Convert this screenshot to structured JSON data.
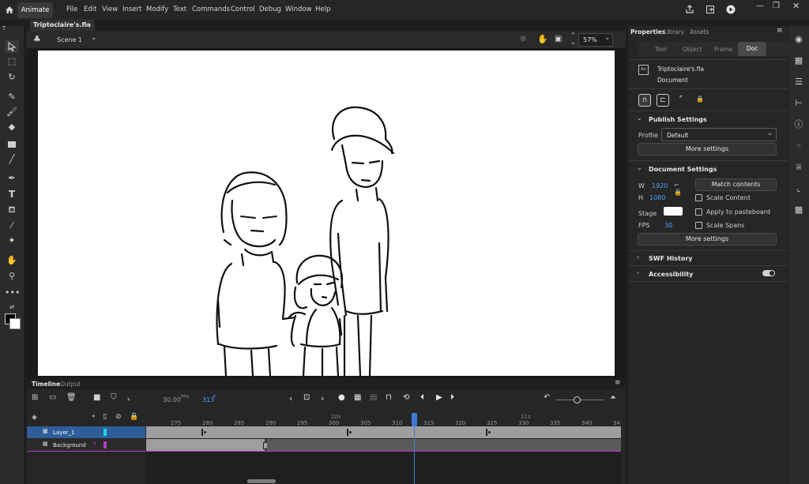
{
  "app": {
    "name": "Animate"
  },
  "menu": [
    "File",
    "Edit",
    "View",
    "Insert",
    "Modify",
    "Text",
    "Commands",
    "Control",
    "Debug",
    "Window",
    "Help"
  ],
  "document": {
    "tab_title": "Triptoclaire's.fla",
    "scene": "Scene 1",
    "zoom": "57%"
  },
  "timeline": {
    "tabs": [
      "Timeline",
      "Output"
    ],
    "fps": "30.00",
    "fps_unit": "FPS",
    "frame": "313",
    "frame_unit": "F",
    "ruler": [
      "275",
      "280",
      "285",
      "290",
      "295",
      "300",
      "305",
      "310",
      "315",
      "320",
      "325",
      "330",
      "335",
      "340",
      "34"
    ],
    "seconds": [
      "10s",
      "11s"
    ],
    "layers": [
      {
        "name": "Layer_1",
        "color": "#17d6ea"
      },
      {
        "name": "Background",
        "color": "#b23ec8"
      }
    ]
  },
  "properties": {
    "tabs": [
      "Properties",
      "Library",
      "Assets"
    ],
    "subtabs": [
      "Tool",
      "Object",
      "Frame",
      "Doc"
    ],
    "active_subtab": "Doc",
    "doc_name": "Triptoclaire's.fla",
    "doc_type": "Document",
    "publish": {
      "title": "Publish Settings",
      "profile_label": "Profile",
      "profile_value": "Default",
      "more": "More settings"
    },
    "doc_settings": {
      "title": "Document Settings",
      "w_label": "W",
      "w": "1920",
      "h_label": "H",
      "h": "1080",
      "match": "Match contents",
      "scale_content": "Scale Content",
      "stage_label": "Stage",
      "apply_paste": "Apply to pasteboard",
      "fps_label": "FPS",
      "fps": "30",
      "scale_spans": "Scale Spans",
      "more": "More settings"
    },
    "swf_history": "SWF History",
    "accessibility": "Accessibility"
  }
}
